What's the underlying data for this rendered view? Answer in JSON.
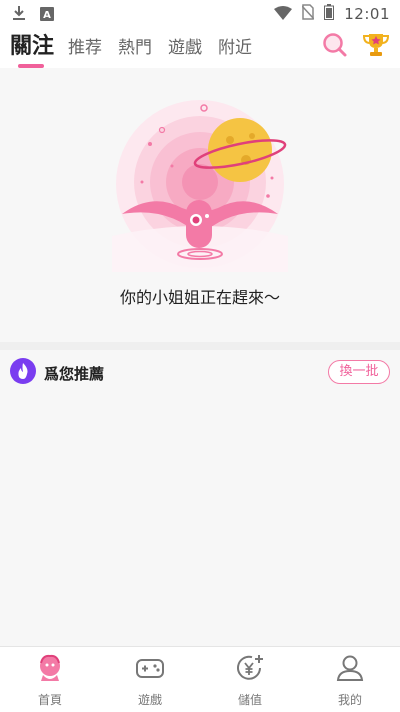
{
  "status_bar": {
    "time": "12:01"
  },
  "top_nav": {
    "tabs": [
      {
        "label": "關注",
        "active": true
      },
      {
        "label": "推荐",
        "active": false
      },
      {
        "label": "熱門",
        "active": false
      },
      {
        "label": "遊戲",
        "active": false
      },
      {
        "label": "附近",
        "active": false
      }
    ],
    "icons": [
      "search-icon",
      "trophy-icon"
    ]
  },
  "empty_state": {
    "message": "你的小姐姐正在趕來～"
  },
  "recommend": {
    "title": "爲您推薦",
    "refresh_label": "換一批"
  },
  "bottom_nav": {
    "items": [
      {
        "label": "首頁",
        "icon": "home-icon",
        "active": true
      },
      {
        "label": "遊戲",
        "icon": "gamepad-icon",
        "active": false
      },
      {
        "label": "儲值",
        "icon": "yen-recharge-icon",
        "active": false
      },
      {
        "label": "我的",
        "icon": "profile-icon",
        "active": false
      }
    ]
  },
  "colors": {
    "accent": "#f0609a",
    "purple": "#7a3df0"
  }
}
